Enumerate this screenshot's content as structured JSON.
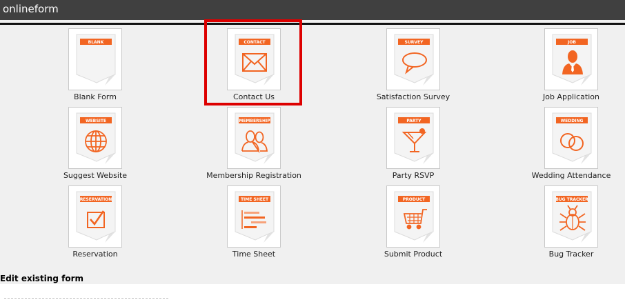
{
  "app": {
    "title": "onlineform"
  },
  "templates": [
    {
      "badge": "BLANK",
      "label": "Blank Form",
      "icon": "blank-icon"
    },
    {
      "badge": "CONTACT",
      "label": "Contact Us",
      "icon": "envelope-icon"
    },
    {
      "badge": "SURVEY",
      "label": "Satisfaction Survey",
      "icon": "speech-bubble-icon"
    },
    {
      "badge": "JOB",
      "label": "Job Application",
      "icon": "person-icon"
    },
    {
      "badge": "WEBSITE",
      "label": "Suggest Website",
      "icon": "globe-icon"
    },
    {
      "badge": "MEMBERSHIP",
      "label": "Membership Registration",
      "icon": "people-icon"
    },
    {
      "badge": "PARTY",
      "label": "Party RSVP",
      "icon": "cocktail-glass-icon"
    },
    {
      "badge": "WEDDING",
      "label": "Wedding Attendance",
      "icon": "wedding-rings-icon"
    },
    {
      "badge": "RESERVATION",
      "label": "Reservation",
      "icon": "checkbox-icon"
    },
    {
      "badge": "TIME SHEET",
      "label": "Time Sheet",
      "icon": "gantt-chart-icon"
    },
    {
      "badge": "PRODUCT",
      "label": "Submit Product",
      "icon": "shopping-cart-icon"
    },
    {
      "badge": "BUG TRACKER",
      "label": "Bug Tracker",
      "icon": "bug-icon"
    }
  ],
  "selected_template": "CONTACT",
  "edit_section": {
    "title": "Edit existing form"
  },
  "colors": {
    "accent": "#f26522",
    "topbar": "#404040",
    "highlight": "#dd0000",
    "background": "#f0f0f0"
  }
}
